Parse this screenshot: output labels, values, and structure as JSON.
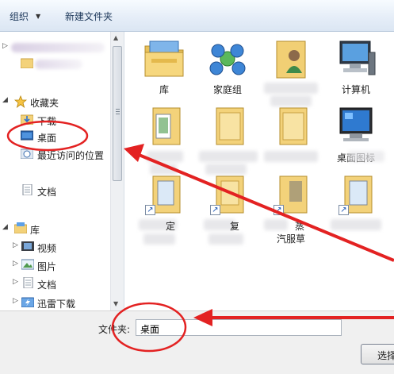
{
  "toolbar": {
    "organize_label": "组织",
    "new_folder_label": "新建文件夹"
  },
  "nav": {
    "favorites_label": "收藏夹",
    "downloads_label": "下载",
    "desktop_label": "桌面",
    "recent_label": "最近访问的位置",
    "documents_label": "文档",
    "libraries_label": "库",
    "videos_label": "视频",
    "pictures_label": "图片",
    "lib_documents_label": "文档",
    "thunder_label": "迅雷下载"
  },
  "content": {
    "items": [
      {
        "label": "库",
        "icon": "library-folder-icon"
      },
      {
        "label": "家庭组",
        "icon": "homegroup-icon"
      },
      {
        "label": "",
        "icon": "user-folder-icon"
      },
      {
        "label": "计算机",
        "icon": "computer-icon"
      },
      {
        "label": "",
        "icon": "folder-icon"
      },
      {
        "label": "",
        "icon": "folder-icon"
      },
      {
        "label": "",
        "icon": "folder-icon"
      },
      {
        "label": "桌面图标",
        "icon": "monitor-icon"
      },
      {
        "label": "定",
        "icon": "shortcut-folder-icon"
      },
      {
        "label": "复",
        "icon": "shortcut-folder-icon"
      },
      {
        "label": "蒸",
        "icon": "shortcut-folder-icon"
      },
      {
        "label": "",
        "icon": "shortcut-folder-icon"
      }
    ],
    "partial_label_2": "汽服草"
  },
  "footer": {
    "folder_label": "文件夹:",
    "folder_value": "桌面",
    "select_button_label": "选择"
  },
  "colors": {
    "annotation": "#e32222",
    "toolbar_text": "#1e395b",
    "selection": "#cde8ff"
  }
}
